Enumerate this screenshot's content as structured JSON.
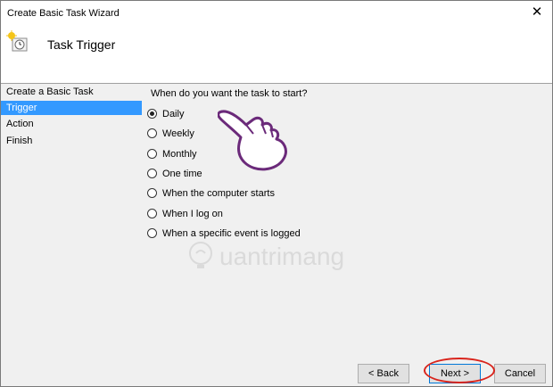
{
  "window": {
    "title": "Create Basic Task Wizard",
    "close_glyph": "✕"
  },
  "header": {
    "title": "Task Trigger",
    "icon": "clock-task-icon"
  },
  "sidebar": {
    "items": [
      {
        "label": "Create a Basic Task",
        "active": false
      },
      {
        "label": "Trigger",
        "active": true
      },
      {
        "label": "Action",
        "active": false
      },
      {
        "label": "Finish",
        "active": false
      }
    ]
  },
  "main": {
    "question": "When do you want the task to start?",
    "options": [
      {
        "label": "Daily",
        "selected": true
      },
      {
        "label": "Weekly",
        "selected": false
      },
      {
        "label": "Monthly",
        "selected": false
      },
      {
        "label": "One time",
        "selected": false
      },
      {
        "label": "When the computer starts",
        "selected": false
      },
      {
        "label": "When I log on",
        "selected": false
      },
      {
        "label": "When a specific event is logged",
        "selected": false
      }
    ]
  },
  "footer": {
    "back_label": "< Back",
    "next_label": "Next >",
    "cancel_label": "Cancel"
  },
  "watermark": {
    "text": "uantrimang"
  },
  "colors": {
    "selection": "#3399ff",
    "highlight_ring": "#d9241c",
    "hand": "#6b2a7a"
  }
}
